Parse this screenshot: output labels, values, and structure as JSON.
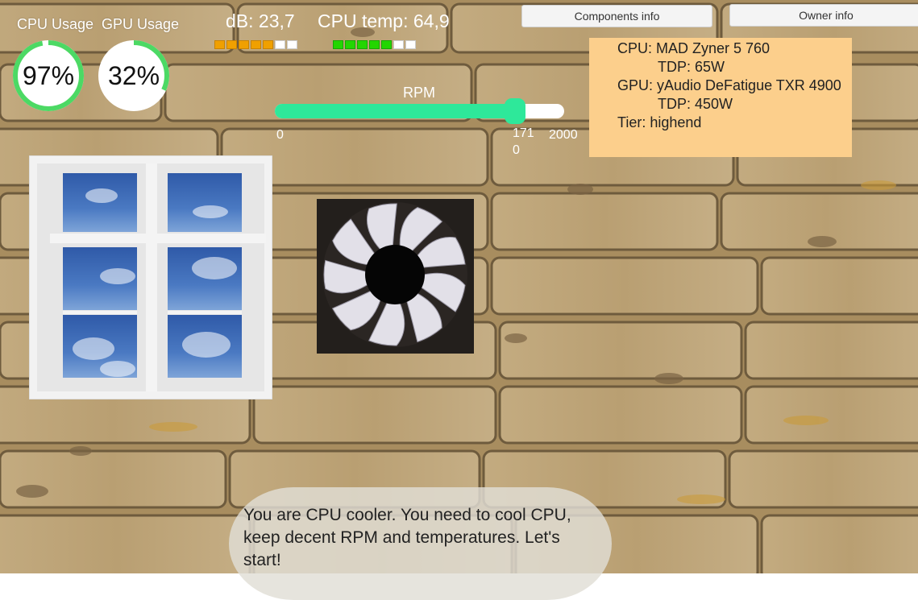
{
  "hud": {
    "cpu_usage_label": "CPU Usage",
    "gpu_usage_label": "GPU Usage",
    "cpu_usage_value": "97%",
    "gpu_usage_value": "32%",
    "cpu_usage_fraction": 0.97,
    "gpu_usage_fraction": 0.32,
    "gauge_color": "#4cd964",
    "db_label": "dB:",
    "db_value": "23,7",
    "db_level_bars": 6,
    "cpu_temp_label": "CPU temp:",
    "cpu_temp_value": "64,9",
    "temp_level_bars": 6,
    "bar_count": 7
  },
  "rpm": {
    "title": "RPM",
    "min_label": "0",
    "max_label": "2000",
    "value_label_line1": "171",
    "value_label_line2": "0",
    "value": 1710,
    "min": 0,
    "max": 2000,
    "accent": "#2ee89a"
  },
  "buttons": {
    "components": "Components info",
    "owner": "Owner info"
  },
  "info_panel": {
    "cpu_line": "CPU: MAD Zyner 5 760",
    "cpu_tdp": "TDP: 65W",
    "gpu_line": "GPU: yAudio DeFatigue TXR 4900",
    "gpu_tdp": "TDP: 450W",
    "tier_line": "Tier: highend",
    "bg_color": "#fccf8c"
  },
  "dialog": {
    "text": "You are CPU cooler. You need to cool CPU, keep decent RPM and temperatures. Let's start!"
  }
}
